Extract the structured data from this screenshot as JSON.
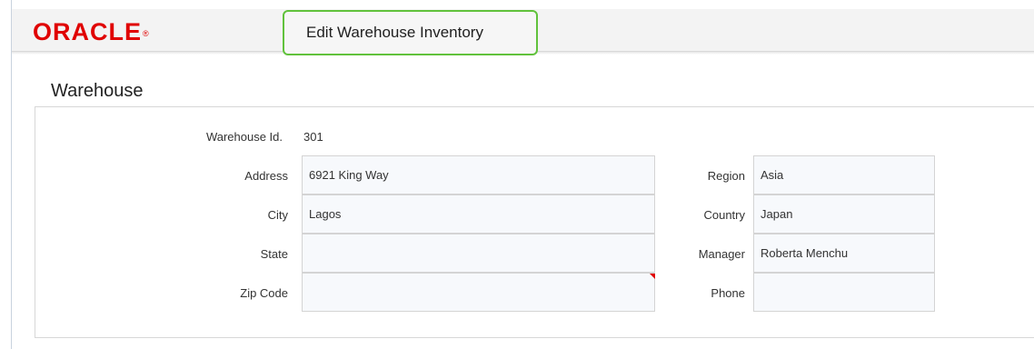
{
  "header": {
    "logo": "ORACLE",
    "logo_mark": "®",
    "page_title": "Edit Warehouse Inventory"
  },
  "section": {
    "title": "Warehouse"
  },
  "form": {
    "warehouse_id_label": "Warehouse Id.",
    "warehouse_id_value": "301",
    "address_label": "Address",
    "address_value": "6921 King Way",
    "city_label": "City",
    "city_value": "Lagos",
    "state_label": "State",
    "state_value": "",
    "zip_label": "Zip Code",
    "zip_value": "",
    "region_label": "Region",
    "region_value": "Asia",
    "country_label": "Country",
    "country_value": "Japan",
    "manager_label": "Manager",
    "manager_value": "Roberta Menchu",
    "phone_label": "Phone",
    "phone_value": ""
  },
  "colors": {
    "brand_red": "#e00000",
    "focus_green": "#61c23c"
  }
}
